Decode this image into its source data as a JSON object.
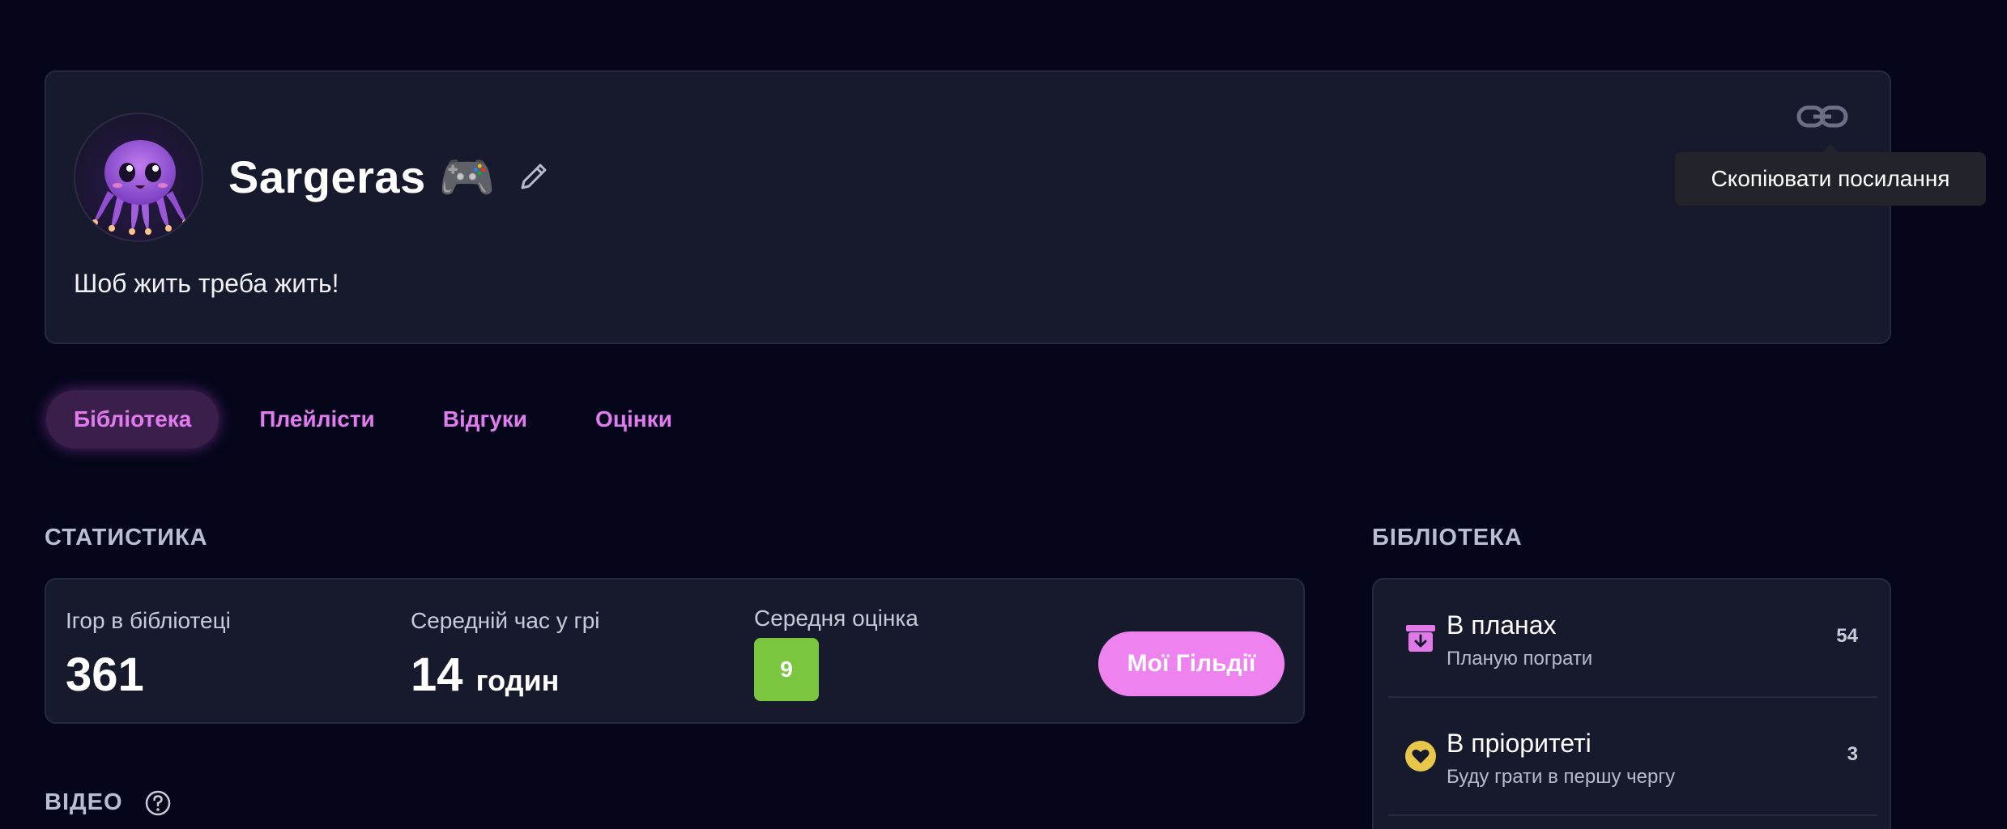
{
  "profile": {
    "username": "Sargeras",
    "username_emoji": "🎮",
    "bio": "Шоб жить треба жить!",
    "avatar": "octopus-avatar",
    "link_icon": "link-icon",
    "edit_icon": "pencil-icon"
  },
  "tooltip": {
    "text": "Скопіювати посилання"
  },
  "tabs": [
    {
      "label": "Бібліотека",
      "active": true
    },
    {
      "label": "Плейлісти",
      "active": false
    },
    {
      "label": "Відгуки",
      "active": false
    },
    {
      "label": "Оцінки",
      "active": false
    }
  ],
  "stats": {
    "heading": "СТАТИСТИКА",
    "games_label": "Ігор в бібліотеці",
    "games_value": "361",
    "avg_time_label": "Середній час у грі",
    "avg_time_value": "14",
    "avg_time_unit": "годин",
    "avg_rating_label": "Середня оцінка",
    "avg_rating_value": "9",
    "guild_button": "Мої Гільдії"
  },
  "video": {
    "heading": "ВІДЕО",
    "help_icon": "question-circle-icon"
  },
  "library": {
    "heading": "БІБЛІОТЕКА",
    "items": [
      {
        "title": "В планах",
        "subtitle": "Планую пограти",
        "count": "54",
        "icon": "archive-download-icon",
        "color": "#e07ae8"
      },
      {
        "title": "В пріоритеті",
        "subtitle": "Буду грати в першу чергу",
        "count": "3",
        "icon": "heart-badge-icon",
        "color": "#e8c64a"
      }
    ]
  },
  "colors": {
    "background": "#05061a",
    "card": "#171a2c",
    "accent": "#ee82ee",
    "tab_text": "#e27af0",
    "rating_green": "#7bc63f"
  }
}
